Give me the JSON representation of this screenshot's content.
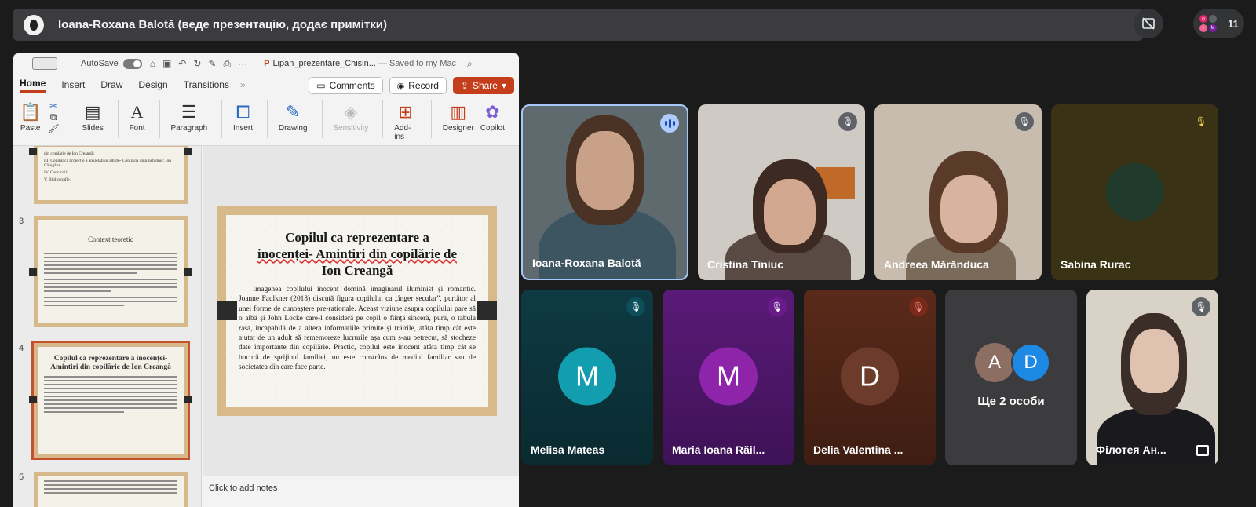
{
  "presenter_bar": {
    "title": "Ioana-Roxana Balotă (веде презентацію, додає примітки)"
  },
  "participants_count": "11",
  "powerpoint": {
    "autosave_label": "AutoSave",
    "document_name": "Lipan_prezentare_Chișin...",
    "saved_status": "— Saved to my Mac",
    "tabs": [
      "Home",
      "Insert",
      "Draw",
      "Design",
      "Transitions"
    ],
    "more_tabs": "»",
    "comments_label": "Comments",
    "record_label": "Record",
    "share_label": "Share",
    "ribbon": {
      "paste": "Paste",
      "slides": "Slides",
      "font": "Font",
      "paragraph": "Paragraph",
      "insert": "Insert",
      "drawing": "Drawing",
      "sensitivity": "Sensitivity",
      "addins": "Add-ins",
      "designer": "Designer",
      "copilot": "Copilot"
    },
    "thumbnails": {
      "slide2_lines": [
        "din copilărie de Ion Creangă;",
        "III. Copilul ca proiecție a anxietăților adulte- Copilăria unui nebotnic: Ion Călugăru;",
        "IV. Concluzii;",
        "V. Bibliografie."
      ],
      "slide3_number": "3",
      "slide3_title": "Context teoretic",
      "slide4_number": "4",
      "slide4_title": "Copilul ca reprezentare a inocenței- Amintiri din copilărie de Ion Creangă",
      "slide5_number": "5"
    },
    "slide": {
      "title_line1": "Copilul ca reprezentare a",
      "title_line2": "inocenței- Amintiri din copilărie de",
      "title_line3": "Ion Creangă",
      "body": "Imagenea copilului inocent domină imaginarul iluminist și romantic. Joanne Faulkner (2018) discută figura copilului ca „înger secular”, purtător al unei forme de cunoaștere pre-rationale. Aceast viziune asupra copilului pare să o aibă și John Locke care-l consideră pe copil o ființă sinceră, pură, o tabula rasa, incapabilă de a altera informațiile primite și trăirile, atâta timp cât este ajutat de un adult să rememoreze lucrurile așa cum s-au petrecut, să stocheze date importante din copilărie. Practic, copilul este inocent atâta timp cât se bucură de sprijinul familiei, nu este constrâns de mediul familiar sau de societatea din care face parte."
    },
    "notes_placeholder": "Click to add notes"
  },
  "tiles": [
    {
      "name": "Ioana-Roxana Balotă",
      "status": "speaking"
    },
    {
      "name": "Cristina Tiniuc",
      "status": "muted"
    },
    {
      "name": "Andreea Mărănduca",
      "status": "muted"
    },
    {
      "name": "Sabina Rurac",
      "status": "muted"
    },
    {
      "name": "Melisa Mateas",
      "initial": "M",
      "status": "muted"
    },
    {
      "name": "Maria Ioana Răil...",
      "initial": "M",
      "status": "muted"
    },
    {
      "name": "Delia Valentina ...",
      "initial": "D",
      "status": "muted"
    },
    {
      "name": "Ще 2 особи",
      "initials": [
        "A",
        "D"
      ]
    },
    {
      "name": "Філотея Ан...",
      "status": "muted"
    }
  ],
  "colors": {
    "background": "#1b1b1b",
    "ppt_accent": "#c43e1c",
    "active_speaker_border": "#a8c7fa"
  }
}
